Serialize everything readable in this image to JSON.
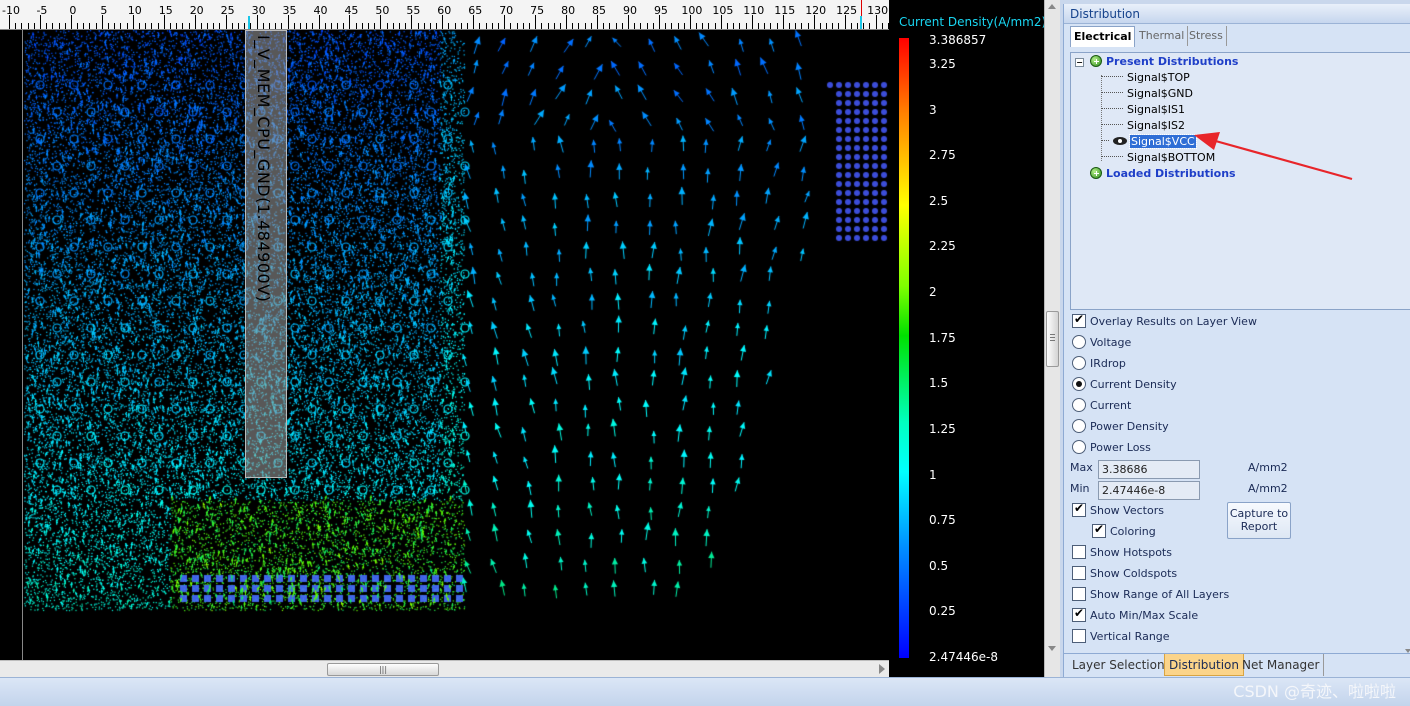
{
  "ruler": {
    "labels": [
      "-10",
      "-5",
      "0",
      "5",
      "10",
      "15",
      "20",
      "25",
      "30",
      "35",
      "40",
      "45",
      "50",
      "55",
      "60",
      "65",
      "70",
      "75",
      "80",
      "85",
      "90",
      "95",
      "100",
      "105",
      "110",
      "115",
      "120",
      "125",
      "130"
    ]
  },
  "net_label": "I_V_MEM_CPU_GND(1.484900V)",
  "legend": {
    "title": "Current Density(A/mm2)",
    "labels": [
      "3.386857",
      "3.25",
      "3",
      "2.75",
      "2.5",
      "2.25",
      "2",
      "1.75",
      "1.5",
      "1.25",
      "1",
      "0.75",
      "0.5",
      "0.25",
      "2.47446e-8"
    ]
  },
  "panel": {
    "title": "Distribution",
    "tabs": [
      "Electrical",
      "Thermal",
      "Stress"
    ],
    "tree": {
      "present_header": "Present Distributions",
      "signals": [
        "Signal$TOP",
        "Signal$GND",
        "Signal$IS1",
        "Signal$IS2",
        "Signal$VCC",
        "Signal$BOTTOM"
      ],
      "selected_signal": "Signal$VCC",
      "loaded_header": "Loaded Distributions"
    },
    "overlay_label": "Overlay Results on Layer View",
    "overlay_checked": true,
    "radios": [
      {
        "label": "Voltage",
        "selected": false
      },
      {
        "label": "IRdrop",
        "selected": false
      },
      {
        "label": "Current Density",
        "selected": true
      },
      {
        "label": "Current",
        "selected": false
      },
      {
        "label": "Power Density",
        "selected": false
      },
      {
        "label": "Power Loss",
        "selected": false
      }
    ],
    "max_label": "Max",
    "max_value": "3.38686",
    "max_unit": "A/mm2",
    "min_label": "Min",
    "min_value": "2.47446e-8",
    "min_unit": "A/mm2",
    "show_vectors_label": "Show Vectors",
    "coloring_label": "Coloring",
    "capture_label": "Capture to Report",
    "checks": [
      {
        "label": "Show Hotspots",
        "checked": false
      },
      {
        "label": "Show Coldspots",
        "checked": false
      },
      {
        "label": "Show Range of All Layers",
        "checked": false
      },
      {
        "label": "Auto Min/Max Scale",
        "checked": true
      },
      {
        "label": "Vertical Range",
        "checked": false
      }
    ],
    "bottom_tabs": [
      "Layer Selection",
      "Distribution",
      "Net Manager"
    ],
    "active_bottom_tab": "Distribution"
  },
  "watermark": "CSDN @奇迹、啦啦啦",
  "colors": {
    "accent_text": "#19d6f2",
    "selection": "#2f6ed6",
    "annotation": "#e8252a",
    "active_tab": "#fbd48a"
  }
}
